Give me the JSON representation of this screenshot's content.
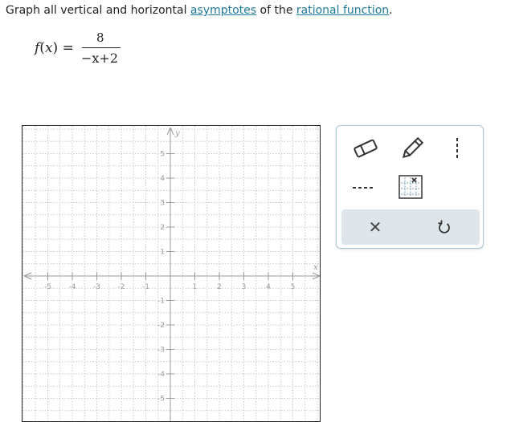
{
  "prompt": {
    "text_before": "Graph all vertical and horizontal ",
    "link1": "asymptotes",
    "text_middle": " of the ",
    "link2": "rational function",
    "text_end": "."
  },
  "equation": {
    "lhs_f": "f",
    "lhs_paren_open": "(",
    "lhs_x": "x",
    "lhs_paren_close": ")",
    "equals": "=",
    "numerator": "8",
    "denominator": "−x+2"
  },
  "graph": {
    "x_axis_label": "x",
    "y_axis_label": "y",
    "x_range": [
      -5,
      5
    ],
    "y_range": [
      -5,
      5
    ],
    "minor_step": 0.5,
    "x_ticks": [
      "-5",
      "-4",
      "-3",
      "-2",
      "-1",
      "1",
      "2",
      "3",
      "4",
      "5"
    ],
    "y_ticks": [
      "5",
      "4",
      "3",
      "2",
      "1",
      "-1",
      "-2",
      "-3",
      "-4",
      "-5"
    ],
    "grid": true,
    "colors": {
      "grid": "#c8c8c8",
      "axis": "#9a9a9a",
      "label": "#9a9a9a"
    }
  },
  "toolbar": {
    "tools": [
      {
        "name": "eraser-tool",
        "icon": "eraser-icon"
      },
      {
        "name": "pencil-tool",
        "icon": "pencil-icon"
      },
      {
        "name": "more-options-tool",
        "icon": "more-vertical-icon"
      },
      {
        "name": "dashed-line-tool",
        "icon": "dashed-line-icon"
      },
      {
        "name": "asymptote-graph-tool",
        "icon": "graph-grid-icon"
      }
    ],
    "clear_symbol": "✕",
    "colors": {
      "border": "#a9c7d6",
      "action_bg": "#dfe6eb",
      "icon": "#333333",
      "accent": "#1f7a9c"
    }
  }
}
